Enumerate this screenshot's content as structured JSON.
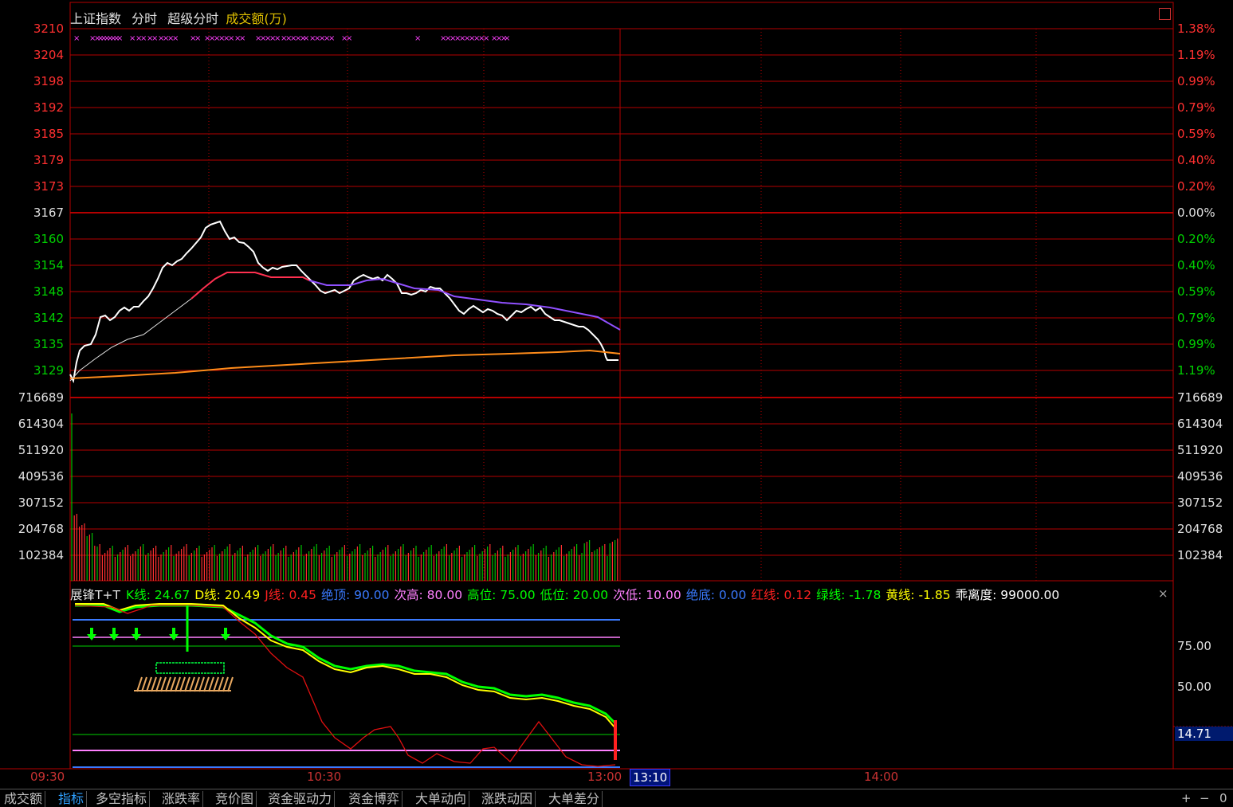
{
  "header": {
    "index_name": "上证指数",
    "mode_intraday": "分时",
    "mode_super": "超级分时",
    "volume_label": "成交额(万)"
  },
  "price_axis": {
    "left": [
      "3210",
      "3204",
      "3198",
      "3192",
      "3185",
      "3179",
      "3173",
      "3167",
      "3160",
      "3154",
      "3148",
      "3142",
      "3135",
      "3129"
    ],
    "right": [
      "1.38%",
      "1.19%",
      "0.99%",
      "0.79%",
      "0.59%",
      "0.40%",
      "0.20%",
      "0.00%",
      "0.20%",
      "0.40%",
      "0.59%",
      "0.79%",
      "0.99%",
      "1.19%"
    ]
  },
  "volume_axis": {
    "left": [
      "716689",
      "614304",
      "511920",
      "409536",
      "307152",
      "204768",
      "102384"
    ],
    "right": [
      "716689",
      "614304",
      "511920",
      "409536",
      "307152",
      "204768",
      "102384"
    ]
  },
  "indicator": {
    "name": "展锋T+T",
    "items": [
      {
        "label": "K线:",
        "value": "24.67",
        "color": "#00ff00"
      },
      {
        "label": "D线:",
        "value": "20.49",
        "color": "#ffff00"
      },
      {
        "label": "J线:",
        "value": "0.45",
        "color": "#ff2020"
      },
      {
        "label": "绝顶:",
        "value": "90.00",
        "color": "#3a7aff"
      },
      {
        "label": "次高:",
        "value": "80.00",
        "color": "#ff80ff"
      },
      {
        "label": "高位:",
        "value": "75.00",
        "color": "#00ff00"
      },
      {
        "label": "低位:",
        "value": "20.00",
        "color": "#00ff00"
      },
      {
        "label": "次低:",
        "value": "10.00",
        "color": "#ff80ff"
      },
      {
        "label": "绝底:",
        "value": "0.00",
        "color": "#3a7aff"
      },
      {
        "label": "红线:",
        "value": "0.12",
        "color": "#ff2020"
      },
      {
        "label": "绿线:",
        "value": "-1.78",
        "color": "#00ff00"
      },
      {
        "label": "黄线:",
        "value": "-1.85",
        "color": "#ffff00"
      },
      {
        "label": "乖离度:",
        "value": "99000.00",
        "color": "#ffffff"
      }
    ],
    "axis": [
      "75.00",
      "50.00"
    ],
    "current_value": "14.71"
  },
  "time_axis": {
    "labels": [
      "09:30",
      "10:30",
      "13:00",
      "14:00"
    ],
    "cursor_time": "13:10"
  },
  "tabs": [
    "成交额",
    "指标",
    "多空指标",
    "涨跌率",
    "竞价图",
    "资金驱动力",
    "资金博弈",
    "大单动向",
    "涨跌动因",
    "大单差分"
  ],
  "active_tab": "指标",
  "controls": {
    "plus": "+",
    "minus": "−",
    "zero": "0"
  },
  "colors": {
    "grid": "#b40000",
    "price_line": "#ffffff",
    "avg_line": "#ff8c1a",
    "ma_red": "#ff3050",
    "ma_purple": "#9050ff",
    "up_bar": "#ff3030",
    "down_bar": "#00c000"
  }
}
